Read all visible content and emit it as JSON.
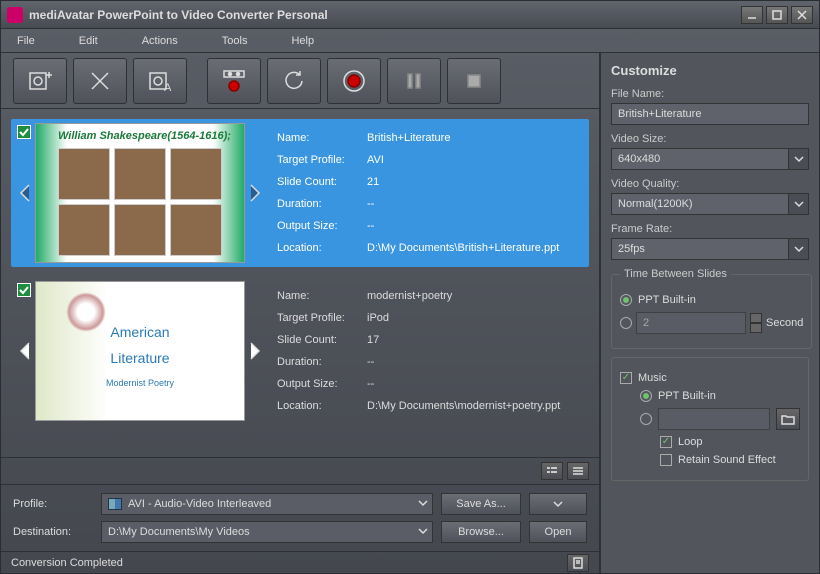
{
  "title": "mediAvatar PowerPoint to Video Converter Personal",
  "menu": {
    "file": "File",
    "edit": "Edit",
    "actions": "Actions",
    "tools": "Tools",
    "help": "Help"
  },
  "items": [
    {
      "thumb_title": "William Shakespeare(1564-1616);",
      "name_label": "Name:",
      "name": "British+Literature",
      "profile_label": "Target Profile:",
      "profile": "AVI",
      "slides_label": "Slide Count:",
      "slides": "21",
      "duration_label": "Duration:",
      "duration": "--",
      "output_label": "Output Size:",
      "output": "--",
      "location_label": "Location:",
      "location": "D:\\My Documents\\British+Literature.ppt"
    },
    {
      "thumb_line1": "American",
      "thumb_line2": "Literature",
      "thumb_line3": "Modernist Poetry",
      "name_label": "Name:",
      "name": "modernist+poetry",
      "profile_label": "Target Profile:",
      "profile": "iPod",
      "slides_label": "Slide Count:",
      "slides": "17",
      "duration_label": "Duration:",
      "duration": "--",
      "output_label": "Output Size:",
      "output": "--",
      "location_label": "Location:",
      "location": "D:\\My Documents\\modernist+poetry.ppt"
    }
  ],
  "profile": {
    "label": "Profile:",
    "value": "AVI - Audio-Video Interleaved",
    "saveas": "Save As...",
    "saveas_chev": "▼"
  },
  "destination": {
    "label": "Destination:",
    "value": "D:\\My Documents\\My Videos",
    "browse": "Browse...",
    "open": "Open"
  },
  "status": "Conversion Completed",
  "customize": {
    "title": "Customize",
    "filename_label": "File Name:",
    "filename": "British+Literature",
    "videosize_label": "Video Size:",
    "videosize": "640x480",
    "quality_label": "Video Quality:",
    "quality": "Normal(1200K)",
    "framerate_label": "Frame Rate:",
    "framerate": "25fps",
    "time_legend": "Time Between Slides",
    "time_builtin": "PPT Built-in",
    "time_custom_value": "2",
    "time_second": "Second",
    "music_label": "Music",
    "music_builtin": "PPT Built-in",
    "loop": "Loop",
    "retain": "Retain Sound Effect"
  }
}
